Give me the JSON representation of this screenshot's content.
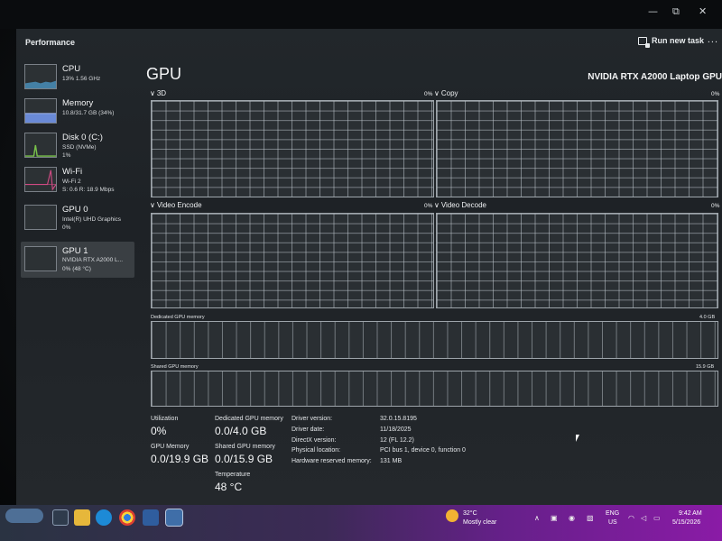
{
  "window": {
    "title": "Performance",
    "run_new_task": "Run new task",
    "more": "..."
  },
  "sidebar": {
    "items": [
      {
        "title": "CPU",
        "line1": "13% 1.56 GHz",
        "line2": ""
      },
      {
        "title": "Memory",
        "line1": "10.8/31.7 GB (34%)",
        "line2": ""
      },
      {
        "title": "Disk 0 (C:)",
        "line1": "SSD (NVMe)",
        "line2": "1%"
      },
      {
        "title": "Wi-Fi",
        "line1": "Wi-Fi 2",
        "line2": "S: 0.6 R: 18.9 Mbps"
      },
      {
        "title": "GPU 0",
        "line1": "Intel(R) UHD Graphics",
        "line2": "0%"
      },
      {
        "title": "GPU 1",
        "line1": "NVIDIA RTX A2000 L...",
        "line2": "0% (48 °C)"
      }
    ],
    "selected_index": 5,
    "colors": {
      "cpu": "#4fa3d6",
      "memory": "#6a8ad6",
      "disk": "#79c24a",
      "wifi": "#d04a83",
      "gpu": "#7d8a93"
    }
  },
  "main": {
    "title": "GPU",
    "model": "NVIDIA RTX A2000 Laptop GPU",
    "engines": [
      {
        "label": "3D",
        "pct": "0%"
      },
      {
        "label": "Copy",
        "pct": "0%"
      },
      {
        "label": "Video Encode",
        "pct": "0%"
      },
      {
        "label": "Video Decode",
        "pct": "0%"
      }
    ],
    "dedicated_memory": {
      "label": "Dedicated GPU memory",
      "max": "4.0 GB"
    },
    "shared_memory": {
      "label": "Shared GPU memory",
      "max": "15.9 GB"
    },
    "stats": {
      "utilization_label": "Utilization",
      "utilization_value": "0%",
      "dedicated_label": "Dedicated GPU memory",
      "dedicated_value": "0.0/4.0 GB",
      "gpu_memory_label": "GPU Memory",
      "gpu_memory_value": "0.0/19.9 GB",
      "shared_label": "Shared GPU memory",
      "shared_value": "0.0/15.9 GB",
      "temperature_label": "Temperature",
      "temperature_value": "48 °C"
    },
    "info": [
      {
        "label": "Driver version:",
        "value": "32.0.15.8195"
      },
      {
        "label": "Driver date:",
        "value": "11/18/2025"
      },
      {
        "label": "DirectX version:",
        "value": "12 (FL 12.2)"
      },
      {
        "label": "Physical location:",
        "value": "PCI bus 1, device 0, function 0"
      },
      {
        "label": "Hardware reserved memory:",
        "value": "131 MB"
      }
    ]
  },
  "taskbar": {
    "weather_temp": "32°C",
    "weather_desc": "Mostly clear",
    "lang": "ENG",
    "region": "US",
    "time": "9:42 AM",
    "date": "5/15/2026"
  }
}
